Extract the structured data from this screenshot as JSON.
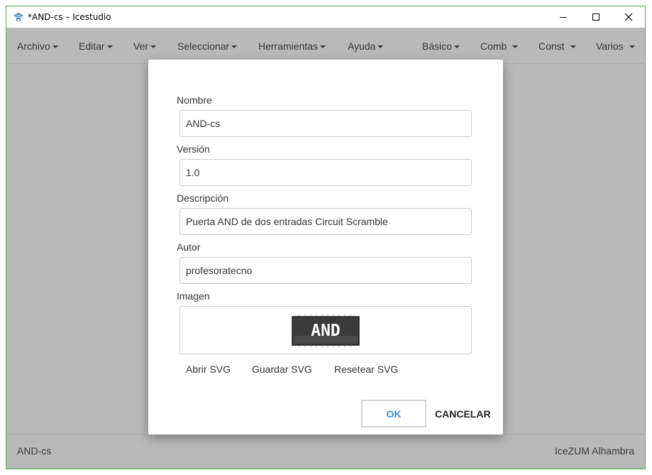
{
  "window": {
    "title": "*AND-cs – Icestudio"
  },
  "menu": {
    "items": [
      {
        "label": "Archivo"
      },
      {
        "label": "Editar"
      },
      {
        "label": "Ver"
      },
      {
        "label": "Seleccionar"
      },
      {
        "label": "Herramientas"
      },
      {
        "label": "Ayuda"
      },
      {
        "label": "Básico"
      },
      {
        "label": "Comb"
      },
      {
        "label": "Const"
      },
      {
        "label": "Varios"
      }
    ]
  },
  "status": {
    "left": "AND-cs",
    "right": "IceZUM Alhambra"
  },
  "dialog": {
    "name_label": "Nombre",
    "name_value": "AND-cs",
    "version_label": "Versión",
    "version_value": "1.0",
    "description_label": "Descripción",
    "description_value": "Puerta AND de dos entradas Circuit Scramble",
    "author_label": "Autor",
    "author_value": "profesoratecno",
    "image_label": "Imagen",
    "image_text": "AND",
    "open_svg": "Abrir SVG",
    "save_svg": "Guardar SVG",
    "reset_svg": "Resetear SVG",
    "ok": "OK",
    "cancel": "CANCELAR"
  },
  "colors": {
    "backdrop": "#b9b9b9",
    "ok_text": "#3a8fd1",
    "window_border": "#5aa55a"
  }
}
